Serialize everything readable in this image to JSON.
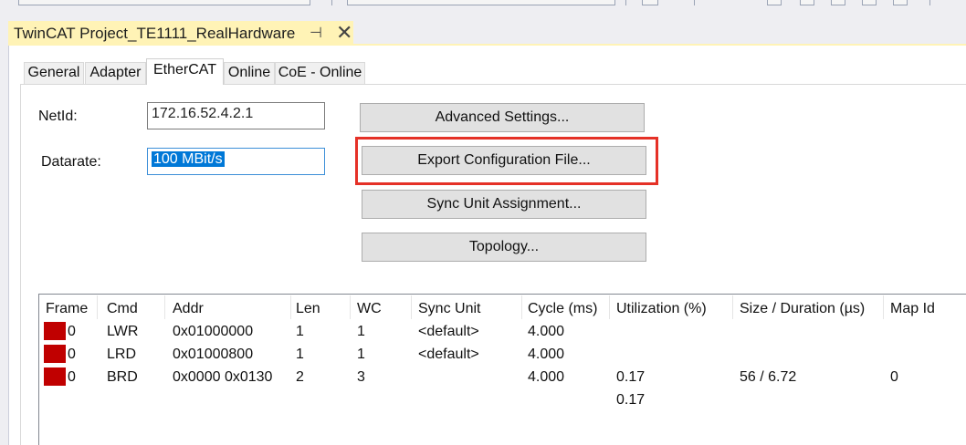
{
  "document": {
    "tab_title": "TwinCAT Project_TE1111_RealHardware",
    "pin_glyph": "⊣",
    "close_glyph": "✕"
  },
  "tabs": [
    {
      "label": "General"
    },
    {
      "label": "Adapter"
    },
    {
      "label": "EtherCAT",
      "active": true
    },
    {
      "label": "Online"
    },
    {
      "label": "CoE - Online"
    }
  ],
  "form": {
    "netid_label": "NetId:",
    "netid_value": "172.16.52.4.2.1",
    "datarate_label": "Datarate:",
    "datarate_value": "100 MBit/s"
  },
  "buttons": {
    "advanced": "Advanced Settings...",
    "export": "Export Configuration File...",
    "sync_unit": "Sync Unit Assignment...",
    "topology": "Topology..."
  },
  "table": {
    "headers": [
      "Frame",
      "Cmd",
      "Addr",
      "Len",
      "WC",
      "Sync Unit",
      "Cycle (ms)",
      "Utilization (%)",
      "Size / Duration (µs)",
      "Map Id"
    ],
    "rows": [
      {
        "frame": "0",
        "cmd": "LWR",
        "addr": "0x01000000",
        "len": "1",
        "wc": "1",
        "sync_unit": "<default>",
        "cycle": "4.000",
        "utilization": "",
        "size_duration": "",
        "map_id": ""
      },
      {
        "frame": "0",
        "cmd": "LRD",
        "addr": "0x01000800",
        "len": "1",
        "wc": "1",
        "sync_unit": "<default>",
        "cycle": "4.000",
        "utilization": "",
        "size_duration": "",
        "map_id": ""
      },
      {
        "frame": "0",
        "cmd": "BRD",
        "addr": "0x0000 0x0130",
        "len": "2",
        "wc": "3",
        "sync_unit": "",
        "cycle": "4.000",
        "utilization": "0.17",
        "size_duration": "56 / 6.72",
        "map_id": "0"
      }
    ],
    "total_utilization": "0.17"
  },
  "colors": {
    "tab_yellow": "#fff3b6",
    "highlight_red": "#e53127",
    "frame_marker": "#c00000",
    "selection_blue": "#0078d7"
  }
}
